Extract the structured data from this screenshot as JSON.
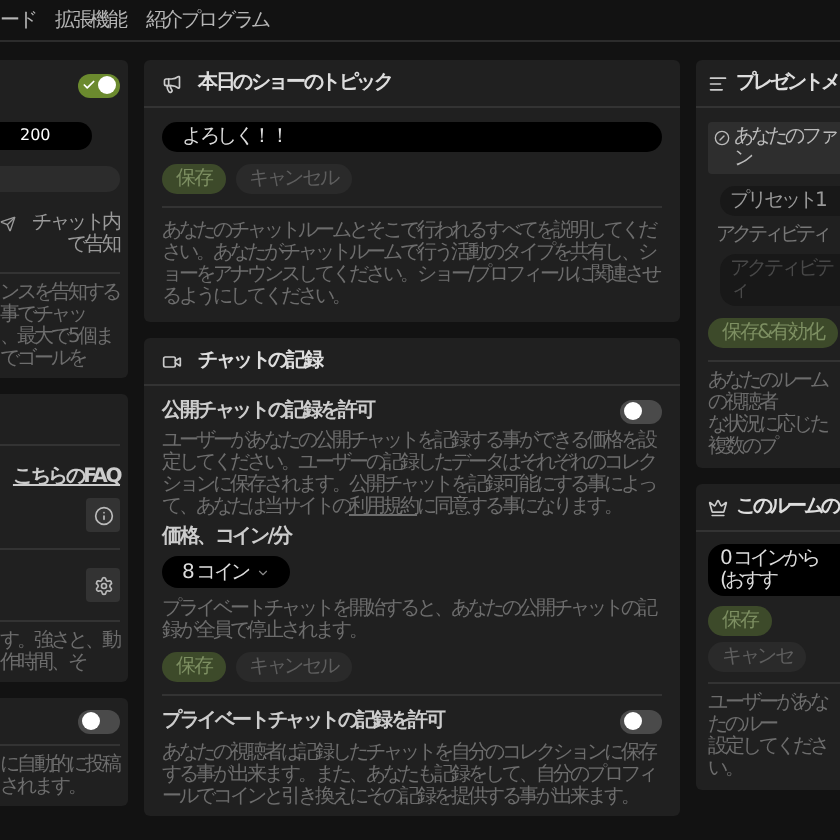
{
  "nav": [
    {
      "label": "ード"
    },
    {
      "label": "拡張機能"
    },
    {
      "label": "紹介プログラム"
    }
  ],
  "left": {
    "goal_card": {
      "enabled": true,
      "amount": "200",
      "announce": "チャット内で告知",
      "description_lines": [
        "ンスを告知する事でチャッ",
        "、最大で5個までゴールを"
      ]
    },
    "faq_card": {
      "faq_link": "こちらのFAQ",
      "description_line": "す。強さと、動作時間、そ"
    },
    "auto_card": {
      "enabled": false,
      "description_line": "に自動的に投稿されます。"
    }
  },
  "topic_card": {
    "title": "本日のショーのトピック",
    "value": "よろしく！！",
    "buttons": [
      {
        "label": "保存",
        "kind": "primary"
      },
      {
        "label": "キャンセル",
        "kind": "secondary"
      }
    ],
    "description": "あなたのチャットルームとそこで行われるすべてを説明してください。あなたがチャットルームで行う活動のタイプを共有し、ショーをアナウンスしてください。ショー/プロフィールに関連させるようにしてください。"
  },
  "recording_card": {
    "title": "チャットの記録",
    "public": {
      "title": "公開チャットの記録を許可",
      "on": false,
      "description": "ユーザーがあなたの公開チャットを記録する事ができる価格を設定してください。ユーザーの記録したデータはそれぞれのコレクションに保存されます。公開チャットを記録可能にする事によって、あなたは当サイトの",
      "link": "利用規約",
      "description_end": "に同意する事になります。",
      "price_label": "価格、コイン/分",
      "price": "8 コイン",
      "note": "プライベートチャットを開始すると、あなたの公開チャットの記録が全員で停止されます。",
      "buttons": [
        {
          "label": "保存",
          "kind": "primary"
        },
        {
          "label": "キャンセル",
          "kind": "secondary"
        }
      ]
    },
    "private": {
      "title": "プライベートチャットの記録を許可",
      "on": false,
      "description": "あなたの視聴者は記録したチャットを自分のコレクションに保存する事が出来ます。また、あなたも記録をして、自分のプロフィールでコインと引き換えにその記録を提供する事が出来ます。"
    }
  },
  "gift_menu_card": {
    "title": "プレゼントメ",
    "audience": "あなたのファン",
    "preset": "プリセット1",
    "activity_label": "アクティビティ",
    "activity_placeholder": "アクティビティ",
    "buttons": [
      {
        "label": "保存&有効化",
        "kind": "primary"
      }
    ],
    "description_lines": [
      "あなたのルームの視聴者",
      "な状況に応じた複数のプ"
    ]
  },
  "room_price_card": {
    "title": "このルームの",
    "min_price": "0 コインから (おすす",
    "buttons": [
      {
        "label": "保存",
        "kind": "primary"
      },
      {
        "label": "キャンセ",
        "kind": "secondary"
      }
    ],
    "description_lines": [
      "ユーザーがあなたのルー",
      "設定してください。"
    ]
  }
}
